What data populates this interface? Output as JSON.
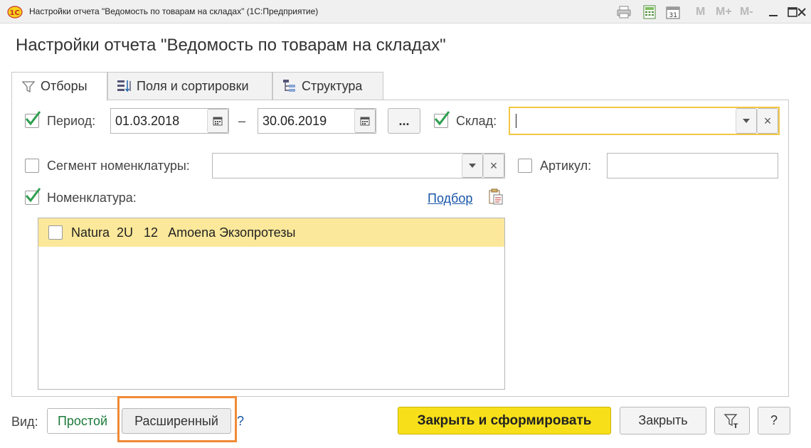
{
  "window": {
    "title": "Настройки отчета \"Ведомость по товарам на складах\"  (1С:Предприятие)",
    "logo_icon": "1c-logo-icon",
    "toolbar_icons": [
      "print-icon",
      "calculator-icon",
      "calendar-icon"
    ],
    "memory_buttons": [
      "M",
      "M+",
      "M-"
    ]
  },
  "heading": "Настройки отчета \"Ведомость по товарам на складах\"",
  "tabs": [
    {
      "label": "Отборы",
      "icon": "filter-icon",
      "active": true
    },
    {
      "label": "Поля и сортировки",
      "icon": "fields-sort-icon",
      "active": false
    },
    {
      "label": "Структура",
      "icon": "structure-icon",
      "active": false
    }
  ],
  "filters": {
    "period": {
      "label": "Период:",
      "checked": true,
      "from": "01.03.2018",
      "dash": "–",
      "to": "30.06.2019",
      "more_label": "..."
    },
    "warehouse": {
      "label": "Склад:",
      "checked": true,
      "value": "",
      "clear_glyph": "×"
    },
    "segment": {
      "label": "Сегмент номенклатуры:",
      "checked": false,
      "value": "",
      "clear_glyph": "×"
    },
    "article": {
      "label": "Артикул:",
      "checked": false,
      "value": ""
    },
    "nomenclature": {
      "label": "Номенклатура:",
      "checked": true,
      "pick_link": "Подбор",
      "items": [
        {
          "text": "Natura  2U   12   Amoena Экзопротезы",
          "checked": false,
          "selected": true
        }
      ]
    }
  },
  "footer": {
    "view_label": "Вид:",
    "simple": "Простой",
    "extended": "Расширенный",
    "help_q": "?",
    "close_and_build": "Закрыть и сформировать",
    "close": "Закрыть",
    "help": "?"
  },
  "colors": {
    "accent_yellow": "#f7e01a",
    "selected_row": "#fbe89a",
    "check_green": "#2e9e4f",
    "link_blue": "#1a56a8",
    "focus_border": "#f2c744",
    "highlight_orange": "#f08a35"
  }
}
